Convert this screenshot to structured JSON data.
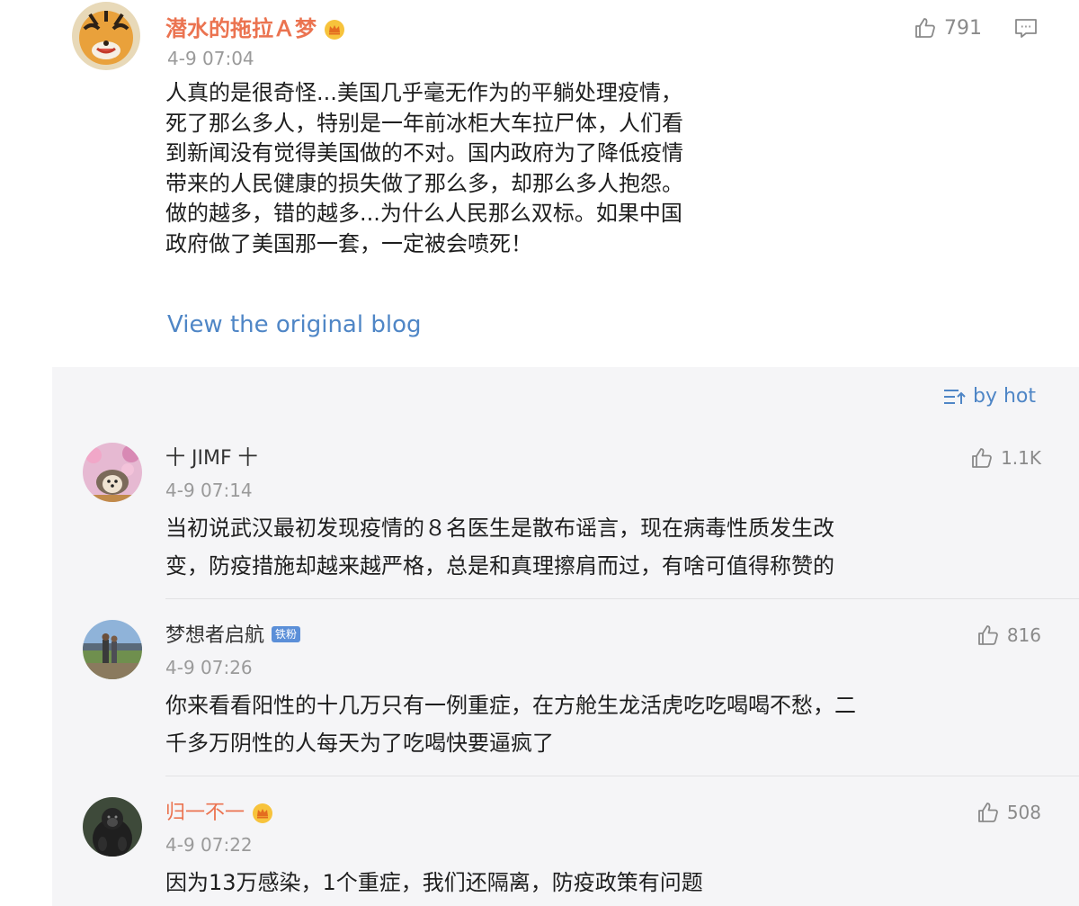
{
  "main_comment": {
    "username": "潜水的拖拉Ａ梦",
    "timestamp": "4-9 07:04",
    "likes": "791",
    "lines": [
      "人真的是很奇怪...美国几乎毫无作为的平躺处理疫情，",
      "死了那么多人，特别是一年前冰柜大车拉尸体，人们看",
      "到新闻没有觉得美国做的不对。国内政府为了降低疫情",
      "带来的人民健康的损失做了那么多，却那么多人抱怨。",
      "做的越多，错的越多...为什么人民那么双标。如果中国",
      "政府做了美国那一套，一定被会喷死！"
    ],
    "view_original": "View the original blog"
  },
  "sort": {
    "label": "by hot"
  },
  "replies": [
    {
      "username": "十 JIMF 十",
      "timestamp": "4-9 07:14",
      "likes": "1.1K",
      "lines": [
        "当初说武汉最初发现疫情的８名医生是散布谣言，现在病毒性质发生改",
        "变，防疫措施却越来越严格，总是和真理擦肩而过，有啥可值得称赞的"
      ]
    },
    {
      "username": "梦想者启航",
      "badge": "铁粉",
      "timestamp": "4-9 07:26",
      "likes": "816",
      "lines": [
        "你来看看阳性的十几万只有一例重症，在方舱生龙活虎吃吃喝喝不愁，二",
        "千多万阴性的人每天为了吃喝快要逼疯了"
      ]
    },
    {
      "username": "归一不一",
      "timestamp": "4-9 07:22",
      "likes": "508",
      "lines": [
        "因为13万感染，1个重症，我们还隔离，防疫政策有问题"
      ]
    }
  ],
  "colors": {
    "vip_name": "#eb7350",
    "link_blue": "#4f86c6",
    "panel_bg": "#f5f5f7"
  }
}
